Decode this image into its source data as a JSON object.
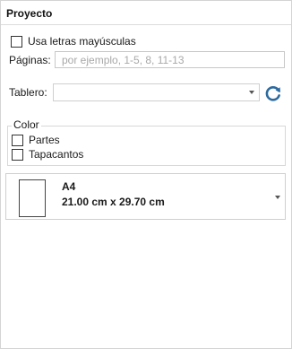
{
  "panel": {
    "title": "Proyecto"
  },
  "uppercase": {
    "label": "Usa letras mayúsculas",
    "checked": false
  },
  "pages": {
    "label": "Páginas:",
    "placeholder": "por ejemplo, 1-5, 8, 11-13",
    "value": ""
  },
  "board": {
    "label": "Tablero:",
    "selected": "",
    "refresh_icon": "refresh-icon"
  },
  "color": {
    "title": "Color",
    "options": [
      {
        "label": "Partes",
        "checked": false
      },
      {
        "label": "Tapacantos",
        "checked": false
      }
    ]
  },
  "paper": {
    "name": "A4",
    "dimensions": "21.00 cm x 29.70 cm"
  },
  "colors": {
    "accent": "#2d6a9f",
    "border": "#d4d4d4"
  }
}
